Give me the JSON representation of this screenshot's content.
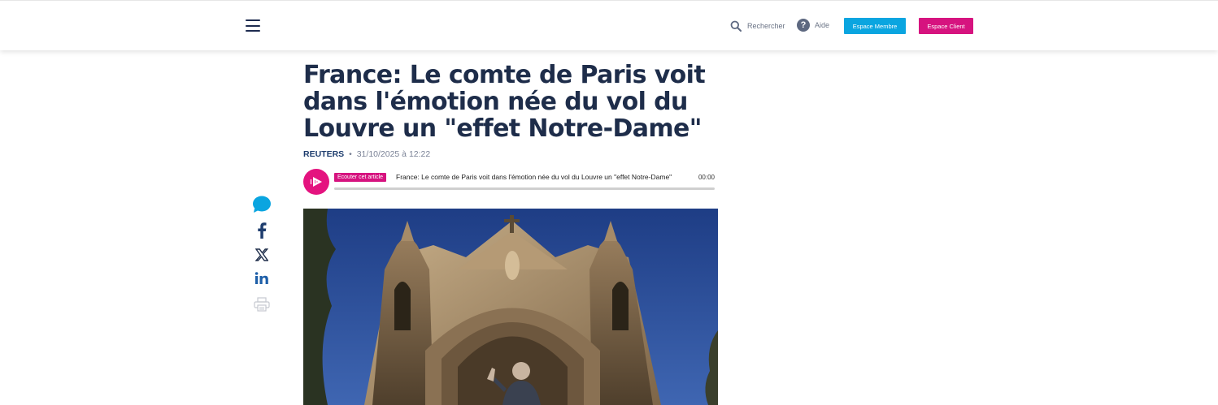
{
  "header": {
    "search_label": "Rechercher",
    "help_label": "Aide",
    "member_button": "Espace Membre",
    "client_button": "Espace Client"
  },
  "article": {
    "title": "France: Le comte de Paris voit dans l'émotion née du vol du Louvre un \"effet Notre-Dame\"",
    "source": "REUTERS",
    "separator": "•",
    "date": "31/10/2025 à 12:22"
  },
  "player": {
    "badge": "Ecouter cet article",
    "title": "France: Le comte de Paris voit dans l'émotion née du vol du Louvre un \"effet Notre-Dame\"",
    "time": "00:00",
    "progress": 0
  },
  "social": {
    "icons": [
      "comment-icon",
      "facebook-icon",
      "x-icon",
      "linkedin-icon",
      "print-icon"
    ]
  },
  "colors": {
    "brand_blue": "#0aa5e0",
    "brand_pink": "#d6137f",
    "title": "#1e2d4a"
  }
}
